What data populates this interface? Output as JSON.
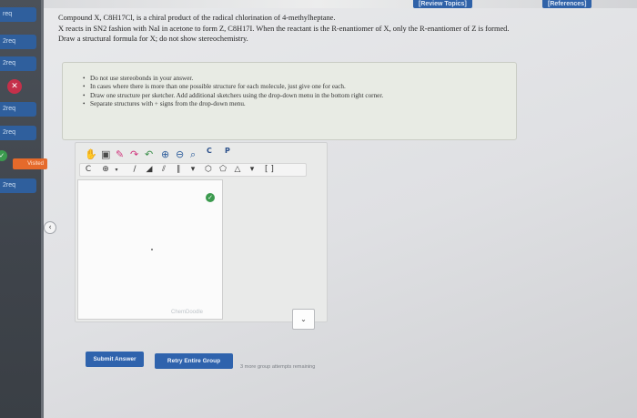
{
  "topbar": {
    "review_topics": "[Review Topics]",
    "references": "[References]"
  },
  "sidebar": {
    "items": [
      {
        "label": "req"
      },
      {
        "label": "2req"
      },
      {
        "label": "2req"
      },
      {
        "label": "2req"
      },
      {
        "label": "2req"
      },
      {
        "label": "2req"
      }
    ],
    "visited_label": "Visited",
    "error_icon": "x-circle-icon",
    "info_icon": "i-circle-icon"
  },
  "question": {
    "line1": "Compound X, C8H17Cl, is a chiral product of the radical chlorination of 4-methylheptane.",
    "line2": "X reacts in SN2 fashion with NaI in acetone to form Z, C8H17I. When the reactant is the R-enantiomer of X, only the R-enantiomer of Z is formed.",
    "line3": "Draw a structural formula for X; do not show stereochemistry."
  },
  "instructions": [
    "Do not use stereobonds in your answer.",
    "In cases where there is more than one possible structure for each molecule, just give one for each.",
    "Draw one structure per sketcher. Add additional sketchers using the drop-down menu in the bottom right corner.",
    "Separate structures with + signs from the drop-down menu."
  ],
  "sketcher": {
    "tools_row1": [
      "hand-icon",
      "eraser-icon",
      "pencil-icon",
      "lasso-icon",
      "zoom-in-icon",
      "zoom-out-icon",
      "copy-icon",
      "paste-icon"
    ],
    "copy_label": "C",
    "paste_label": "P",
    "row2": {
      "charge": "C",
      "atom_menu": "⊕",
      "ring": "⬡",
      "brackets": "[ ]"
    },
    "watermark": "ChemDoodle",
    "status_icon": "check-circle-icon",
    "dropdown_icon": "chevron-down-icon"
  },
  "buttons": {
    "submit": "Submit Answer",
    "retry": "Retry Entire Group"
  },
  "attempts_text": "3 more group attempts remaining",
  "colors": {
    "accent": "#2f63ad",
    "visited": "#e56a2b",
    "error": "#c5304a",
    "success": "#3b9a4e"
  }
}
